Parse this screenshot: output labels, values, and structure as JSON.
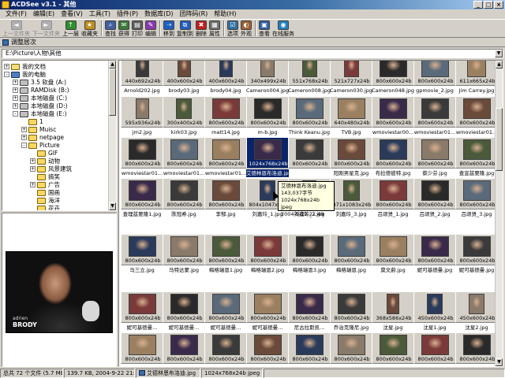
{
  "window": {
    "title": "ACDSee v3.1 - 其他",
    "buttons": [
      "_",
      "□",
      "×"
    ]
  },
  "menu": [
    "文件(F)",
    "编辑(E)",
    "查看(V)",
    "工具(T)",
    "插件(P)",
    "数据库(D)",
    "团阵码(R)",
    "帮助(H)"
  ],
  "toolbar": [
    {
      "label": "上一文件夹",
      "icon": "◄",
      "color": "#a0a0a0",
      "disabled": true
    },
    {
      "label": "下一文件夹",
      "icon": "►",
      "color": "#a0a0a0",
      "disabled": true
    },
    {
      "label": "上一层",
      "icon": "↑",
      "color": "#2f8f2f"
    },
    {
      "label": "收藏夹",
      "icon": "★",
      "color": "#c09020"
    },
    {
      "sep": true
    },
    {
      "label": "查找",
      "icon": "⌕",
      "color": "#4060a0"
    },
    {
      "label": "获得",
      "icon": "✉",
      "color": "#3a7a3a"
    },
    {
      "label": "打印",
      "icon": "▤",
      "color": "#606060"
    },
    {
      "label": "编辑",
      "icon": "✎",
      "color": "#8a3ab0"
    },
    {
      "sep": true
    },
    {
      "label": "移到",
      "icon": "➝",
      "color": "#2060c0"
    },
    {
      "label": "复制到",
      "icon": "⧉",
      "color": "#2060c0"
    },
    {
      "label": "删除",
      "icon": "✖",
      "color": "#c02020"
    },
    {
      "label": "属性",
      "icon": "▦",
      "color": "#707070"
    },
    {
      "sep": true
    },
    {
      "label": "选项",
      "icon": "☑",
      "color": "#3070a0"
    },
    {
      "label": "外观",
      "icon": "◐",
      "color": "#a06030"
    },
    {
      "sep": true
    },
    {
      "label": "查看",
      "icon": "▣",
      "color": "#3060a0"
    },
    {
      "label": "在线服务",
      "icon": "◉",
      "color": "#2080c0"
    }
  ],
  "panel_title": "调整居次",
  "address": "E:\\Picture\\人物\\其他",
  "tree": [
    {
      "label": "我的文档",
      "depth": 0,
      "type": "docs",
      "exp": "+"
    },
    {
      "label": "我的电脑",
      "depth": 0,
      "type": "pc",
      "exp": "-"
    },
    {
      "label": "3.5 软盘 (A:)",
      "depth": 1,
      "type": "drive",
      "exp": "+"
    },
    {
      "label": "RAMDisk (B:)",
      "depth": 1,
      "type": "drive",
      "exp": "+"
    },
    {
      "label": "本地磁盘 (C:)",
      "depth": 1,
      "type": "drive",
      "exp": "+"
    },
    {
      "label": "本地磁盘 (D:)",
      "depth": 1,
      "type": "drive",
      "exp": "+"
    },
    {
      "label": "本地磁盘 (E:)",
      "depth": 1,
      "type": "drive",
      "exp": "-"
    },
    {
      "label": "1",
      "depth": 2,
      "type": "folder",
      "exp": ""
    },
    {
      "label": "Muisc",
      "depth": 2,
      "type": "folder",
      "exp": "+"
    },
    {
      "label": "netpage",
      "depth": 2,
      "type": "folder",
      "exp": "+"
    },
    {
      "label": "Picture",
      "depth": 2,
      "type": "folder",
      "exp": "-"
    },
    {
      "label": "GIF",
      "depth": 3,
      "type": "folder",
      "exp": ""
    },
    {
      "label": "动物",
      "depth": 3,
      "type": "folder",
      "exp": "+"
    },
    {
      "label": "风景建筑",
      "depth": 3,
      "type": "folder",
      "exp": "+"
    },
    {
      "label": "搞笑",
      "depth": 3,
      "type": "folder",
      "exp": ""
    },
    {
      "label": "广告",
      "depth": 3,
      "type": "folder",
      "exp": "+"
    },
    {
      "label": "国画",
      "depth": 3,
      "type": "folder",
      "exp": ""
    },
    {
      "label": "海洋",
      "depth": 3,
      "type": "folder",
      "exp": ""
    },
    {
      "label": "花卉",
      "depth": 3,
      "type": "folder",
      "exp": ""
    }
  ],
  "preview": {
    "caption_small": "adrien",
    "caption_big": "BRODY"
  },
  "thumbs": [
    [
      "440x692x24b|Arnold202.jpg",
      "400x600x24b|brody03.jpg",
      "400x600x24b|brody04.jpg",
      "340x499x24b|Cameron004.jpg",
      "551x768x24b|Cameron008.jpg",
      "521x727x24b|Cameron030.jpg",
      "800x600x24b|Cameron048.jpg",
      "800x600x24b|gpmovie_2.jpg",
      "611x665x24b|Jim Carrey.jpg"
    ],
    [
      "595x936x24b|jm2.jpg",
      "300x400x24b|kirk03.jpg",
      "800x600x24b|matt14.jpg",
      "800x600x24b|m-b.jpg",
      "800x600x24b|Think Keanu.jpg",
      "640x480x24b|TVB.jpg",
      "800x600x24b|wmoviestar00...",
      "800x600x24b|wmoviestar01...",
      "800x600x24b|wmoviestar01..."
    ],
    [
      "800x600x24b|wmoviestar01...",
      "800x600x24b|wmoviestar01...",
      "800x600x24b|wmoviestar01...",
      "1024x768x24b|艾德林恩布洛迪.jpg",
      "800x600x24b|",
      "800x600x24b|阳刚男星克.jpg",
      "800x600x24b|布拉德彼特.jpg",
      "800x600x24b|蔡少芬.jpg",
      "800x600x24b|查宣兹要隆.jpg"
    ],
    [
      "800x600x24b|查理兹要隆1.jpg",
      "800x600x24b|陈冠希.jpg",
      "800x600x24b|李郁.jpg",
      "804x1047x24b|刘嘉玲_1.jpg",
      "812x1160x24b|刘嘉玲_2.jpg",
      "871x1083x24b|刘嘉玲_3.jpg",
      "800x600x24b|吕颂贤_1.jpg",
      "800x600x24b|吕颂贤_2.jpg",
      "800x600x24b|吕颂贤_3.jpg"
    ],
    [
      "800x600x24b|马三立.jpg",
      "800x600x24b|马特达蒙.jpg",
      "800x600x24b|梅格瑞恩1.jpg",
      "800x600x24b|梅格瑞恩2.jpg",
      "800x600x24b|梅格瑞恩3.jpg",
      "800x600x24b|梅格瑞恩.jpg",
      "800x600x24b|莫文蔚.jpg",
      "800x600x24b|妮可基德曼.jpg",
      "800x600x24b|妮可基德曼.jpg"
    ],
    [
      "800x600x24b|妮可基德曼...",
      "800x600x24b|妮可基德曼...",
      "800x600x24b|妮可基德曼...",
      "800x600x24b|妮可基德曼...",
      "800x600x24b|尼古拉斯凯...",
      "800x600x24b|乔治克隆尼.jpg",
      "368x586x24b|沈星.jpg",
      "450x600x24b|沈星1.jpg",
      "450x600x24b|沈星2.jpg"
    ],
    [
      "800x600x24b|",
      "800x600x24b|",
      "800x600x24b|",
      "800x600x24b|",
      "800x600x24b|",
      "800x600x24b|",
      "800x600x24b|",
      "800x600x24b|",
      "800x600x24b|"
    ]
  ],
  "selected": {
    "row": 2,
    "col": 3
  },
  "tooltip": [
    "艾德林恩布洛迪.jpg",
    "143,037字节",
    "1024x768x24b jpeg",
    "2004-9-22 21:49"
  ],
  "status": [
    "总共 72 个文件 (5.7 MB)",
    "139.7 KB, 2004-9-22 21:49",
    "艾德林恩布洛迪.jpg",
    "1024x768x24b jpeg"
  ]
}
